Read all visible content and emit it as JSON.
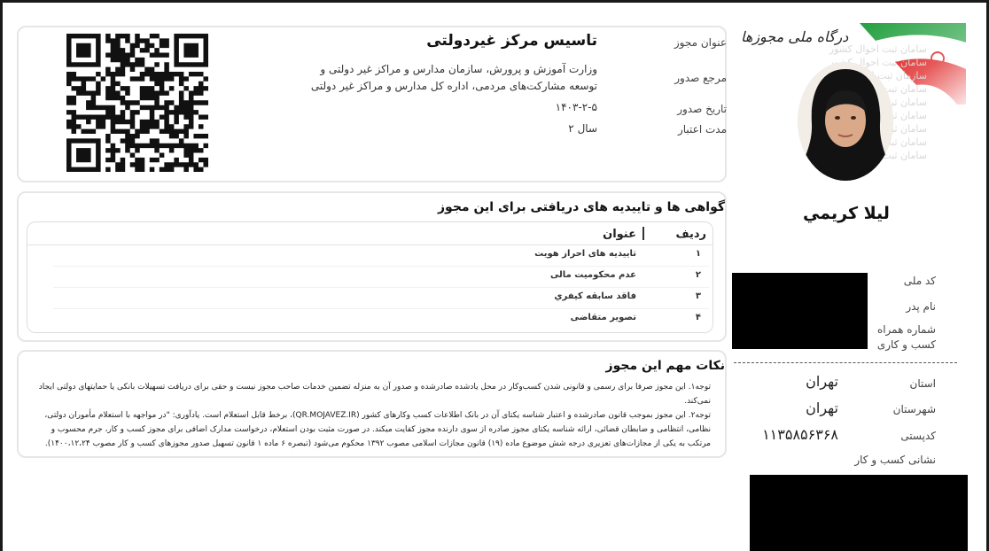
{
  "brand": {
    "name": "درگاه ملی مجوزها"
  },
  "watermark": {
    "lines": [
      "سامان ثبت احوال کشور",
      "سامان ثبت احوال کشور",
      "سازمان ثبت احوال کشور",
      "سامان ثبت احوال کشور",
      "سامان ثبت احوال کشور",
      "سامان ثبت احوال کشور",
      "سامان ثبت احوال کشور",
      "سامان ثبت احوال کشور",
      "سامان ثبت احوال کشور"
    ]
  },
  "person": {
    "name": "ليلا کريمي",
    "labels": {
      "national_code": "کد ملی",
      "father_name": "نام پدر",
      "mobile": "شماره همراه کسب و کاری",
      "province": "استان",
      "city": "شهرستان",
      "postal_code": "کدپستی",
      "address": "نشانی کسب و کار"
    },
    "values": {
      "province": "تهران",
      "city": "تهران",
      "postal_code": "۱۱۳۵۸۵۶۳۶۸"
    }
  },
  "license": {
    "labels": {
      "title": "عنوان مجوز",
      "issuer": "مرجع صدور",
      "issue_date": "تاریخ صدور",
      "validity": "مدت اعتبار"
    },
    "title": "تاسیس مرکز غیردولتی",
    "issuer": "وزارت آموزش و پرورش، سازمان مدارس و مراکز غیر دولتی و توسعه مشارکت‌های مردمی، اداره کل مدارس و مراکز غیر دولتی",
    "issue_date": "۱۴۰۳-۲-۵",
    "validity": "۲ سال"
  },
  "certificates": {
    "title": "گواهی ها و تاییدیه های دریافتی برای این مجوز",
    "headers": {
      "row": "ردیف",
      "title": "عنوان"
    },
    "rows": [
      {
        "num": "۱",
        "title": "تاییدیه های احراز هویت"
      },
      {
        "num": "۲",
        "title": "عدم محکومیت مالی"
      },
      {
        "num": "۳",
        "title": "فاقد سابقه کیفري"
      },
      {
        "num": "۴",
        "title": "تصویر متقاضی"
      }
    ]
  },
  "notes": {
    "title": "نکات مهم این مجوز",
    "paragraphs": [
      "توجه۱. این مجوز صرفا برای رسمی و قانونی شدن کسب‌وکار در محل یادشده صادرشده و صدور آن به منزله تضمین خدمات صاحب مجوز نیست و حقی برای دریافت تسهیلات بانکی یا حمایتهای دولتی ایجاد نمی‌کند.",
      "توجه۲. این مجوز بموجب قانون صادرشده و اعتبار شناسه یکتای آن در بانک اطلاعات کسب وکارهای کشور (QR.MOJAVEZ.IR)، برخط قابل استعلام است. یادآوری: \"در مواجهه با استعلام مأموران دولتی، نظامی، انتظامی و ضابطان قضائی، ارائه شناسه یکتای مجوز صادره از سوی دارنده مجوز کفایت میکند. در صورت مثبت بودن استعلام، درخواست مدارک اضافی برای مجوز کسب و کار، جرم محسوب و مرتکب به یکی از مجازات‌های تعزیری درجه شش موضوع ماده (۱۹) قانون مجازات اسلامی مصوب ۱۳۹۲ محکوم می‌شود (تبصره ۶ ماده ۱ قانون تسهیل صدور مجوزهای کسب و کار مصوب ۱۴۰۰،۱۲،۲۴)."
    ]
  },
  "colors": {
    "flag_green": "#239f40",
    "flag_red": "#da0000",
    "emblem": "#da0000"
  }
}
